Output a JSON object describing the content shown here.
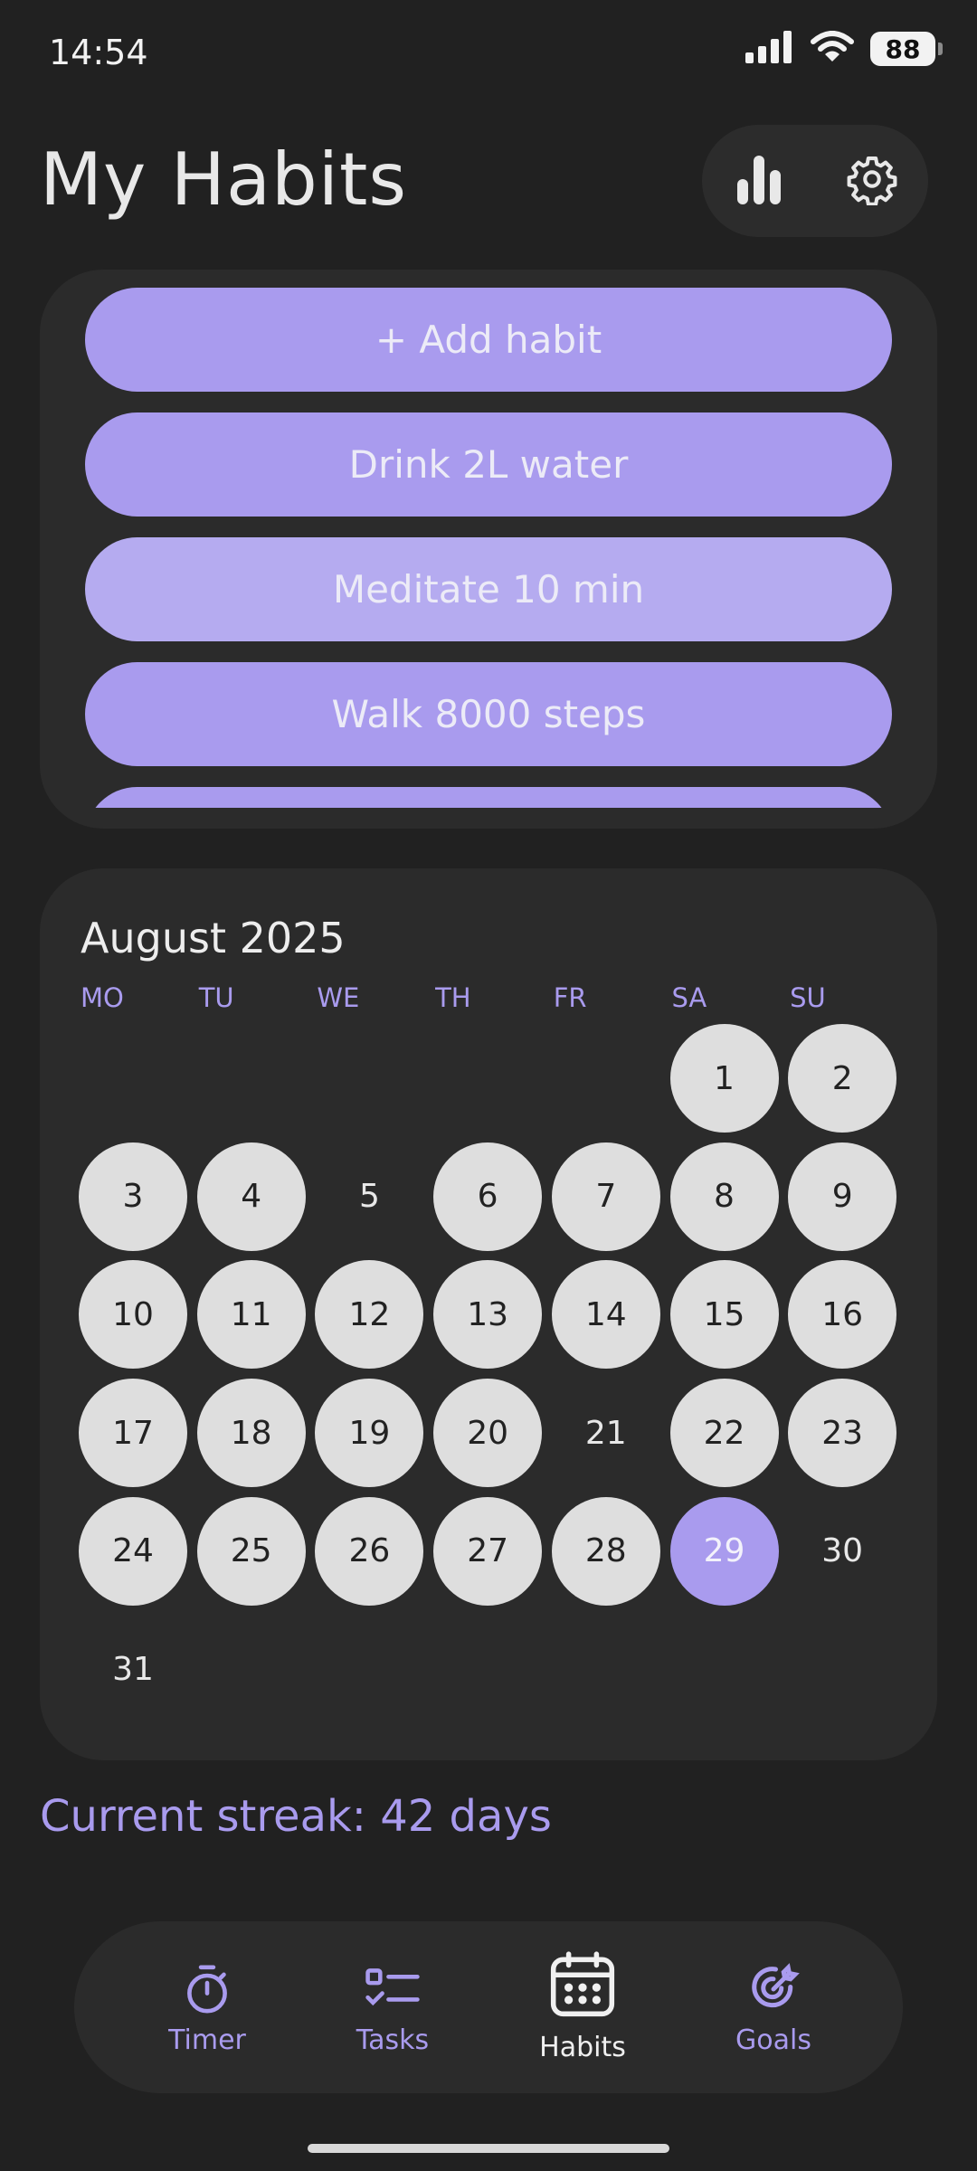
{
  "status_bar": {
    "time": "14:54",
    "battery": "88",
    "icons": [
      "signal-icon",
      "wifi-icon",
      "battery-icon"
    ]
  },
  "header": {
    "title": "My Habits",
    "actions": [
      "stats-icon",
      "gear-icon"
    ]
  },
  "habits": {
    "add_label": "+ Add habit",
    "items": [
      {
        "label": "Drink 2L water",
        "state": "normal"
      },
      {
        "label": "Meditate 10 min",
        "state": "light"
      },
      {
        "label": "Walk 8000 steps",
        "state": "normal"
      }
    ]
  },
  "calendar": {
    "month": "August 2025",
    "weekdays": [
      "MO",
      "TU",
      "WE",
      "TH",
      "FR",
      "SA",
      "SU"
    ],
    "days": [
      {
        "label": "1",
        "state": "done"
      },
      {
        "label": "2",
        "state": "done"
      },
      {
        "label": "3",
        "state": "done"
      },
      {
        "label": "4",
        "state": "done"
      },
      {
        "label": "5",
        "state": "plain"
      },
      {
        "label": "6",
        "state": "done"
      },
      {
        "label": "7",
        "state": "done"
      },
      {
        "label": "8",
        "state": "done"
      },
      {
        "label": "9",
        "state": "done"
      },
      {
        "label": "10",
        "state": "done"
      },
      {
        "label": "11",
        "state": "done"
      },
      {
        "label": "12",
        "state": "done"
      },
      {
        "label": "13",
        "state": "done"
      },
      {
        "label": "14",
        "state": "done"
      },
      {
        "label": "15",
        "state": "done"
      },
      {
        "label": "16",
        "state": "done"
      },
      {
        "label": "17",
        "state": "done"
      },
      {
        "label": "18",
        "state": "done"
      },
      {
        "label": "19",
        "state": "done"
      },
      {
        "label": "20",
        "state": "done"
      },
      {
        "label": "21",
        "state": "plain"
      },
      {
        "label": "22",
        "state": "done"
      },
      {
        "label": "23",
        "state": "done"
      },
      {
        "label": "24",
        "state": "done"
      },
      {
        "label": "25",
        "state": "done"
      },
      {
        "label": "26",
        "state": "done"
      },
      {
        "label": "27",
        "state": "done"
      },
      {
        "label": "28",
        "state": "done"
      },
      {
        "label": "29",
        "state": "today"
      },
      {
        "label": "30",
        "state": "plain"
      },
      {
        "label": "31",
        "state": "plain"
      }
    ]
  },
  "streak": {
    "text": "Current streak: 42 days"
  },
  "nav": {
    "items": [
      {
        "label": "Timer",
        "icon": "timer-icon"
      },
      {
        "label": "Tasks",
        "icon": "tasks-icon"
      },
      {
        "label": "Habits",
        "icon": "calendar-icon",
        "active": true
      },
      {
        "label": "Goals",
        "icon": "goals-icon"
      }
    ]
  },
  "colors": {
    "background": "#212121",
    "panel": "#2b2b2b",
    "accent": "#a99bee",
    "done_day": "#dedede"
  }
}
